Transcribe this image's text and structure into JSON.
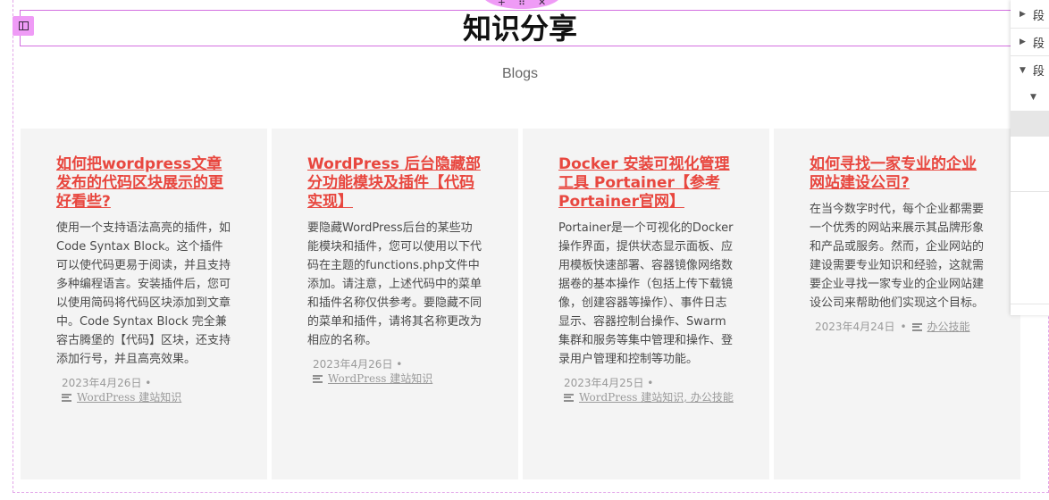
{
  "editor": {
    "top_tab": {
      "add_icon": "plus-icon",
      "move_icon": "grid-dots-icon",
      "close_icon": "close-icon"
    },
    "section_handle_icon": "columns-icon",
    "accent_color": "#ef9bf6"
  },
  "header": {
    "title": "知识分享",
    "subtitle": "Blogs"
  },
  "posts": [
    {
      "title": "如何把wordpress文章发布的代码区块展示的更好看些?",
      "excerpt": "使用一个支持语法高亮的插件，如Code Syntax Block。这个插件可以使代码更易于阅读，并且支持多种编程语言。安装插件后，您可以使用简码将代码区块添加到文章中。Code Syntax Block 完全兼容古腾堡的【代码】区块，还支持添加行号，并且高亮效果。",
      "date": "2023年4月26日",
      "categories": "WordPress 建站知识"
    },
    {
      "title": "WordPress 后台隐藏部分功能模块及插件【代码实现】",
      "excerpt": "要隐藏WordPress后台的某些功能模块和插件，您可以使用以下代码在主题的functions.php文件中添加。请注意，上述代码中的菜单和插件名称仅供参考。要隐藏不同的菜单和插件，请将其名称更改为相应的名称。",
      "date": "2023年4月26日",
      "categories": "WordPress 建站知识"
    },
    {
      "title": "Docker 安装可视化管理工具 Portainer【参考Portainer官网】",
      "excerpt": "Portainer是一个可视化的Docker操作界面，提供状态显示面板、应用模板快速部署、容器镜像网络数据卷的基本操作（包括上传下载镜像，创建容器等操作）、事件日志显示、容器控制台操作、Swarm集群和服务等集中管理和操作、登录用户管理和控制等功能。",
      "date": "2023年4月25日",
      "categories": "WordPress 建站知识, 办公技能"
    },
    {
      "title": "如何寻找一家专业的企业网站建设公司?",
      "excerpt": "在当今数字时代，每个企业都需要一个优秀的网站来展示其品牌形象和产品或服务。然而，企业网站的建设需要专业知识和经验，这就需要企业寻找一家专业的企业网站建设公司来帮助他们实现这个目标。",
      "date": "2023年4月24日",
      "categories": "办公技能"
    }
  ],
  "navigator": {
    "items": [
      {
        "label": "段",
        "caret": "▶"
      },
      {
        "label": "段",
        "caret": "▶"
      },
      {
        "label": "段",
        "caret": "▼"
      },
      {
        "label": "【",
        "caret": "▼"
      }
    ]
  },
  "meta_separator": "•"
}
